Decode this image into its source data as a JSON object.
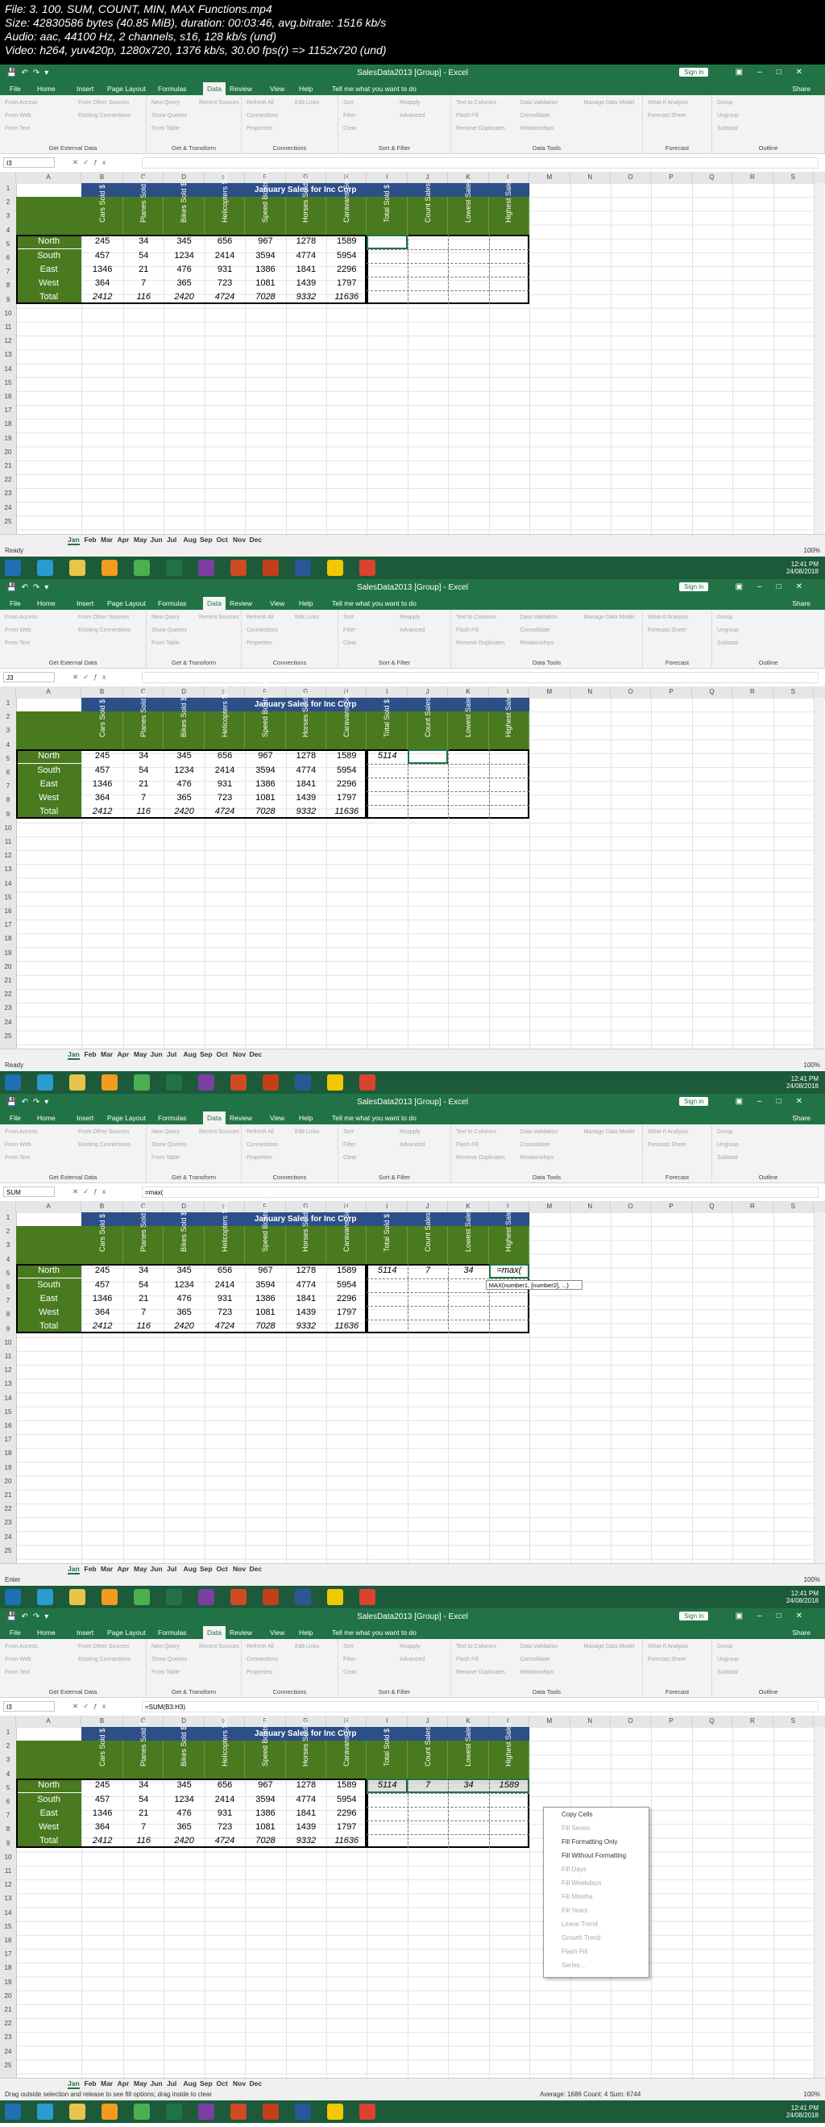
{
  "media_info": {
    "line1": "File: 3. 100. SUM, COUNT, MIN, MAX Functions.mp4",
    "line2": "Size: 42830586 bytes (40.85 MiB), duration: 00:03:46, avg.bitrate: 1516 kb/s",
    "line3": "Audio: aac, 44100 Hz, 2 channels, s16, 128 kb/s (und)",
    "line4": "Video: h264, yuv420p, 1280x720, 1376 kb/s, 30.00 fps(r) => 1152x720 (und)"
  },
  "app": {
    "window_title": "SalesData2013 [Group] - Excel",
    "sign_in": "Sign in",
    "share": "Share",
    "tell_me": "Tell me what you want to do",
    "tabs": [
      "File",
      "Home",
      "Insert",
      "Page Layout",
      "Formulas",
      "Data",
      "Review",
      "View",
      "Help"
    ],
    "active_tab": "Data",
    "ribbon_groups": [
      "Get External Data",
      "Get & Transform",
      "Connections",
      "Sort & Filter",
      "Data Tools",
      "Forecast",
      "Outline"
    ],
    "ribbon_items": {
      "get_external": [
        "From Access",
        "From Web",
        "From Text",
        "From Other Sources",
        "Existing Connections"
      ],
      "get_transform": [
        "New Query",
        "Show Queries",
        "From Table",
        "Recent Sources"
      ],
      "connections": [
        "Refresh All",
        "Connections",
        "Properties",
        "Edit Links"
      ],
      "sort_filter": [
        "Sort",
        "Filter",
        "Clear",
        "Reapply",
        "Advanced"
      ],
      "data_tools": [
        "Text to Columns",
        "Flash Fill",
        "Remove Duplicates",
        "Data Validation",
        "Consolidate",
        "Relationships",
        "Manage Data Model"
      ],
      "forecast": [
        "What-If Analysis",
        "Forecast Sheet"
      ],
      "outline": [
        "Group",
        "Ungroup",
        "Subtotal"
      ]
    },
    "columns": [
      "A",
      "B",
      "C",
      "D",
      "E",
      "F",
      "G",
      "H",
      "I",
      "J",
      "K",
      "L",
      "M",
      "N",
      "O",
      "P",
      "Q",
      "R",
      "S"
    ],
    "rows": [
      "1",
      "2",
      "3",
      "4",
      "5",
      "6",
      "7",
      "8",
      "9",
      "10",
      "11",
      "12",
      "13",
      "14",
      "15",
      "16",
      "17",
      "18",
      "19",
      "20",
      "21",
      "22",
      "23",
      "24",
      "25"
    ],
    "sheet_tabs": [
      "Jan",
      "Feb",
      "Mar",
      "Apr",
      "May",
      "Jun",
      "Jul",
      "Aug",
      "Sep",
      "Oct",
      "Nov",
      "Dec"
    ],
    "zoom": "100%"
  },
  "table": {
    "title": "January Sales for Inc Corp",
    "headers": [
      "Cars Sold $",
      "Planes Sold $",
      "Bikes Sold $",
      "Helicopters Sold $",
      "Speed Boats Sold $",
      "Horses Sold $",
      "Caravans Sold $",
      "Total Sold $",
      "Count Sales",
      "Lowest Sales",
      "Highest Sales"
    ],
    "rows": [
      {
        "label": "North",
        "values": [
          "245",
          "34",
          "345",
          "656",
          "967",
          "1278",
          "1589"
        ]
      },
      {
        "label": "South",
        "values": [
          "457",
          "54",
          "1234",
          "2414",
          "3594",
          "4774",
          "5954"
        ]
      },
      {
        "label": "East",
        "values": [
          "1346",
          "21",
          "476",
          "931",
          "1386",
          "1841",
          "2296"
        ]
      },
      {
        "label": "West",
        "values": [
          "364",
          "7",
          "365",
          "723",
          "1081",
          "1439",
          "1797"
        ]
      },
      {
        "label": "Total",
        "values": [
          "2412",
          "116",
          "2420",
          "4724",
          "7028",
          "9332",
          "11636"
        ]
      }
    ]
  },
  "frames": [
    {
      "name_box": "I3",
      "formula": "",
      "status": "Ready",
      "calc_values": {
        "total": "",
        "count": "",
        "lowest": "",
        "highest": ""
      }
    },
    {
      "name_box": "J3",
      "formula": "",
      "status": "Ready",
      "calc_values": {
        "total": "5114",
        "count": "",
        "lowest": "",
        "highest": ""
      }
    },
    {
      "name_box": "SUM",
      "formula": "=max(",
      "status": "Enter",
      "calc_values": {
        "total": "5114",
        "count": "7",
        "lowest": "34",
        "highest": "=max("
      },
      "tooltip": "MAX(number1, [number2], ...)"
    },
    {
      "name_box": "I3",
      "formula": "=SUM(B3:H3)",
      "status": "Drag outside selection and release to see fill options; drag inside to clear",
      "status_right": "Average: 1686    Count: 4    Sum: 6744",
      "calc_values": {
        "total": "5114",
        "count": "7",
        "lowest": "34",
        "highest": "1589"
      }
    }
  ],
  "context_menu": {
    "items": [
      {
        "label": "Copy Cells",
        "enabled": true
      },
      {
        "label": "Fill Series",
        "enabled": false
      },
      {
        "label": "Fill Formatting Only",
        "enabled": true
      },
      {
        "label": "Fill Without Formatting",
        "enabled": true
      },
      {
        "label": "Fill Days",
        "enabled": false
      },
      {
        "label": "Fill Weekdays",
        "enabled": false
      },
      {
        "label": "Fill Months",
        "enabled": false
      },
      {
        "label": "Fill Years",
        "enabled": false
      },
      {
        "label": "Linear Trend",
        "enabled": false
      },
      {
        "label": "Growth Trend",
        "enabled": false
      },
      {
        "label": "Flash Fill",
        "enabled": false
      },
      {
        "label": "Series...",
        "enabled": false
      }
    ]
  },
  "taskbar": {
    "clock": [
      "12:41 PM",
      "24/08/2018"
    ]
  },
  "colors": {
    "excel_green": "#217346",
    "table_header_green": "#4a7a1f",
    "table_title_blue": "#2d4f87"
  }
}
